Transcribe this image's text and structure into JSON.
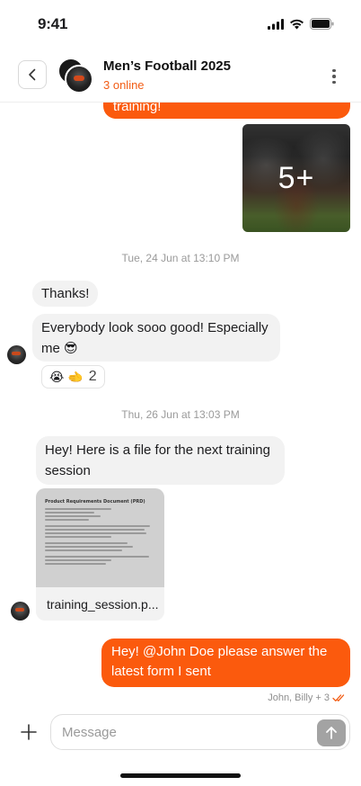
{
  "status_bar": {
    "time": "9:41"
  },
  "header": {
    "title": "Men’s Football 2025",
    "subtitle": "3 online",
    "back_icon": "chevron-left-icon",
    "more_icon": "more-vertical-icon"
  },
  "messages": {
    "out_top_text": "training!",
    "photo_more": "5+",
    "date_1": "Tue, 24 Jun at 13:10 PM",
    "in_1": "Thanks!",
    "in_2": "Everybody look sooo good! Especially me 😎",
    "reaction": {
      "emojis": "😭 🫲",
      "count": "2"
    },
    "date_2": "Thu, 26 Jun at 13:03 PM",
    "in_3": "Hey! Here is a file for the next training session",
    "file": {
      "name": "training_session.p...",
      "doc_title": "Product Requirements Document (PRD)"
    },
    "out_last": "Hey! @John Doe please answer the latest form I sent",
    "read_by": "John, Billy + 3"
  },
  "composer": {
    "placeholder": "Message",
    "plus_icon": "plus-icon",
    "send_icon": "arrow-up-icon"
  },
  "colors": {
    "accent": "#fb5a0d",
    "incoming": "#f2f2f2",
    "online": "#f25c14"
  }
}
